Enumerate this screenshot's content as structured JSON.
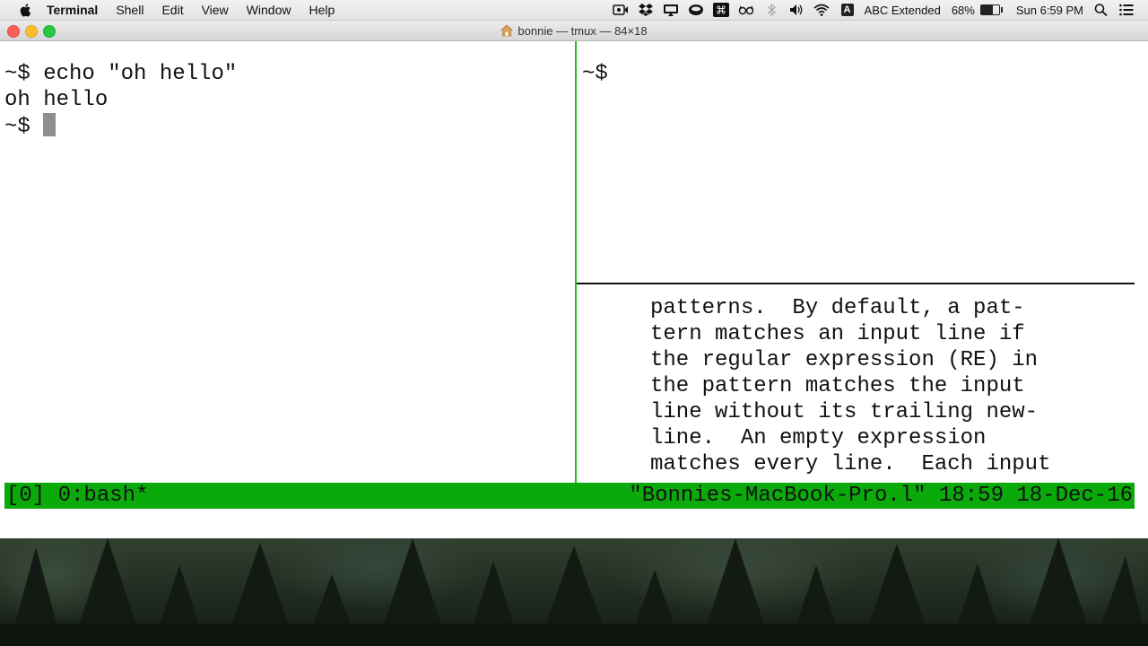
{
  "menubar": {
    "app_name": "Terminal",
    "items": [
      "Shell",
      "Edit",
      "View",
      "Window",
      "Help"
    ],
    "status_icons": [
      "screen-record-icon",
      "dropbox-icon",
      "airplay-display-icon",
      "coffee-cup-icon",
      "command-key-icon",
      "glasses-icon",
      "bluetooth-icon",
      "volume-icon",
      "wifi-icon"
    ],
    "input_source_badge": "A",
    "input_source": "ABC Extended",
    "battery_percent": "68%",
    "battery_level": 0.68,
    "clock": "Sun 6:59 PM"
  },
  "window": {
    "title": "bonnie — tmux — 84×18"
  },
  "panes": {
    "left": {
      "lines": [
        "~$ echo \"oh hello\"",
        "oh hello",
        "~$ "
      ]
    },
    "top_right": {
      "lines": [
        "~$"
      ]
    },
    "bottom_right": {
      "lines": [
        "patterns.  By default, a pat-",
        "tern matches an input line if",
        "the regular expression (RE) in",
        "the pattern matches the input",
        "line without its trailing new-",
        "line.  An empty expression",
        "matches every line.  Each input"
      ],
      "prompt": ":"
    }
  },
  "tmux_status": {
    "left": "[0] 0:bash*",
    "right": "\"Bonnies-MacBook-Pro.l\" 18:59 18-Dec-16",
    "color": "#0aaa0a"
  }
}
